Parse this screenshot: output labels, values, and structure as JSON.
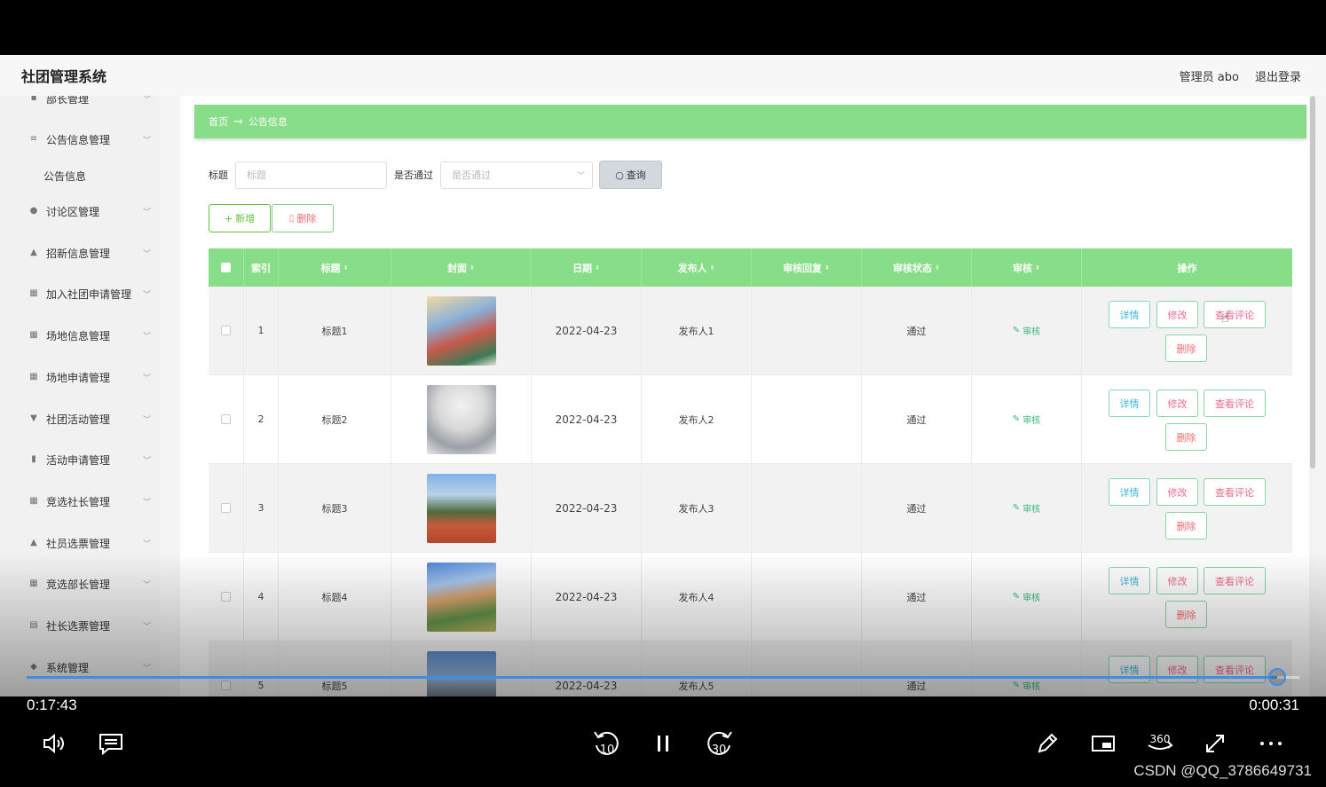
{
  "app": {
    "title": "社团管理系统",
    "admin_label": "管理员 abo",
    "logout_label": "退出登录"
  },
  "sidebar": {
    "items": [
      {
        "label": "部长管理",
        "icon": "doc-icon"
      },
      {
        "label": "公告信息管理",
        "icon": "list-icon"
      },
      {
        "label": "讨论区管理",
        "icon": "pin-icon"
      },
      {
        "label": "招新信息管理",
        "icon": "user-icon"
      },
      {
        "label": "加入社团申请管理",
        "icon": "grid-icon"
      },
      {
        "label": "场地信息管理",
        "icon": "grid-icon"
      },
      {
        "label": "场地申请管理",
        "icon": "grid-icon"
      },
      {
        "label": "社团活动管理",
        "icon": "flag-icon"
      },
      {
        "label": "活动申请管理",
        "icon": "bars-icon"
      },
      {
        "label": "竞选社长管理",
        "icon": "grid-icon"
      },
      {
        "label": "社员选票管理",
        "icon": "user-icon"
      },
      {
        "label": "竞选部长管理",
        "icon": "grid-icon"
      },
      {
        "label": "社长选票管理",
        "icon": "clipboard-icon"
      },
      {
        "label": "系统管理",
        "icon": "folder-icon"
      }
    ],
    "sub_item": "公告信息"
  },
  "breadcrumb": {
    "home": "首页",
    "arrow": "→",
    "current": "公告信息"
  },
  "filter": {
    "title_label": "标题",
    "title_placeholder": "标题",
    "pass_label": "是否通过",
    "pass_placeholder": "是否通过",
    "query_label": "查询"
  },
  "actions": {
    "add_label": "新增",
    "delete_label": "删除"
  },
  "table": {
    "headers": [
      "索引",
      "标题",
      "封面",
      "日期",
      "发布人",
      "审核回复",
      "审核状态",
      "审核",
      "操作"
    ],
    "audit_label": "审核",
    "op_detail": "详情",
    "op_edit": "修改",
    "op_comment": "查看评论",
    "op_delete": "删除",
    "rows": [
      {
        "index": "1",
        "title": "标题1",
        "date": "2022-04-23",
        "publisher": "发布人1",
        "reply": "",
        "status": "通过"
      },
      {
        "index": "2",
        "title": "标题2",
        "date": "2022-04-23",
        "publisher": "发布人2",
        "reply": "",
        "status": "通过"
      },
      {
        "index": "3",
        "title": "标题3",
        "date": "2022-04-23",
        "publisher": "发布人3",
        "reply": "",
        "status": "通过"
      },
      {
        "index": "4",
        "title": "标题4",
        "date": "2022-04-23",
        "publisher": "发布人4",
        "reply": "",
        "status": "通过"
      },
      {
        "index": "5",
        "title": "标题5",
        "date": "2022-04-23",
        "publisher": "发布人5",
        "reply": "",
        "status": "通过"
      }
    ]
  },
  "player": {
    "elapsed": "0:17:43",
    "remaining": "0:00:31",
    "progress": 0.9826,
    "rewind_label": "10",
    "forward_label": "30",
    "vr_label": "360",
    "accent": "#3f8ee6"
  },
  "watermark": "CSDN @QQ_3786649731"
}
